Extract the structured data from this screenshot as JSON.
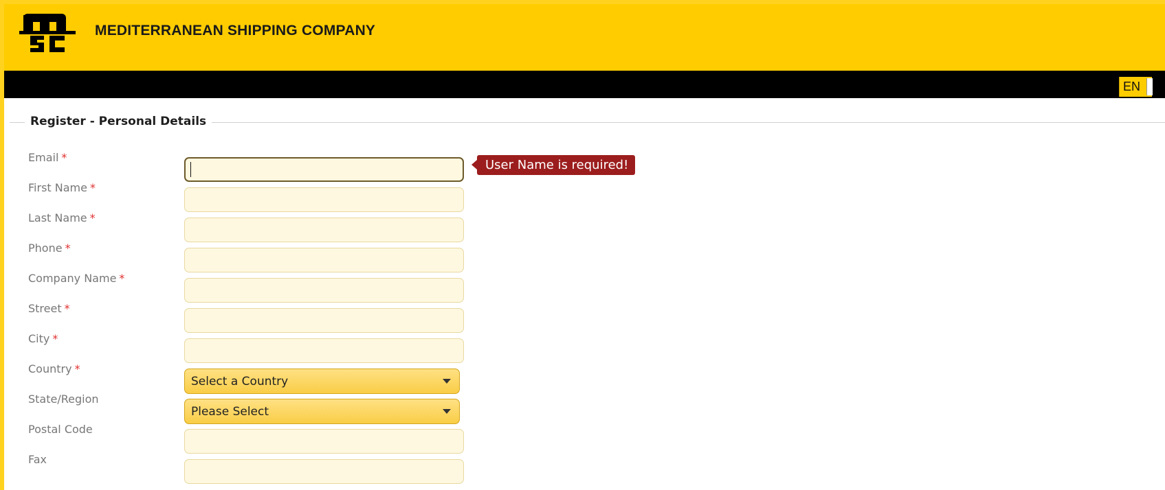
{
  "header": {
    "logo_icon": "msc-logo",
    "company_name": "MEDITERRANEAN SHIPPING COMPANY",
    "background_color": "#ffcc00"
  },
  "navbar": {
    "language": "EN",
    "background_color": "#000000"
  },
  "form": {
    "title": "Register - Personal Details",
    "required_marker": "*",
    "error_message": "User Name is required!",
    "error_color": "#9c1d1d",
    "fields": [
      {
        "label": "Email",
        "value": ""
      },
      {
        "label": "First Name",
        "value": ""
      },
      {
        "label": "Last Name",
        "value": ""
      },
      {
        "label": "Phone",
        "value": ""
      },
      {
        "label": "Company Name",
        "value": ""
      },
      {
        "label": "Street",
        "value": ""
      },
      {
        "label": "City",
        "value": ""
      },
      {
        "label": "Country",
        "value": "Select a Country"
      },
      {
        "label": "State/Region",
        "value": "Please Select"
      },
      {
        "label": "Postal Code",
        "value": ""
      },
      {
        "label": "Fax",
        "value": ""
      }
    ]
  }
}
